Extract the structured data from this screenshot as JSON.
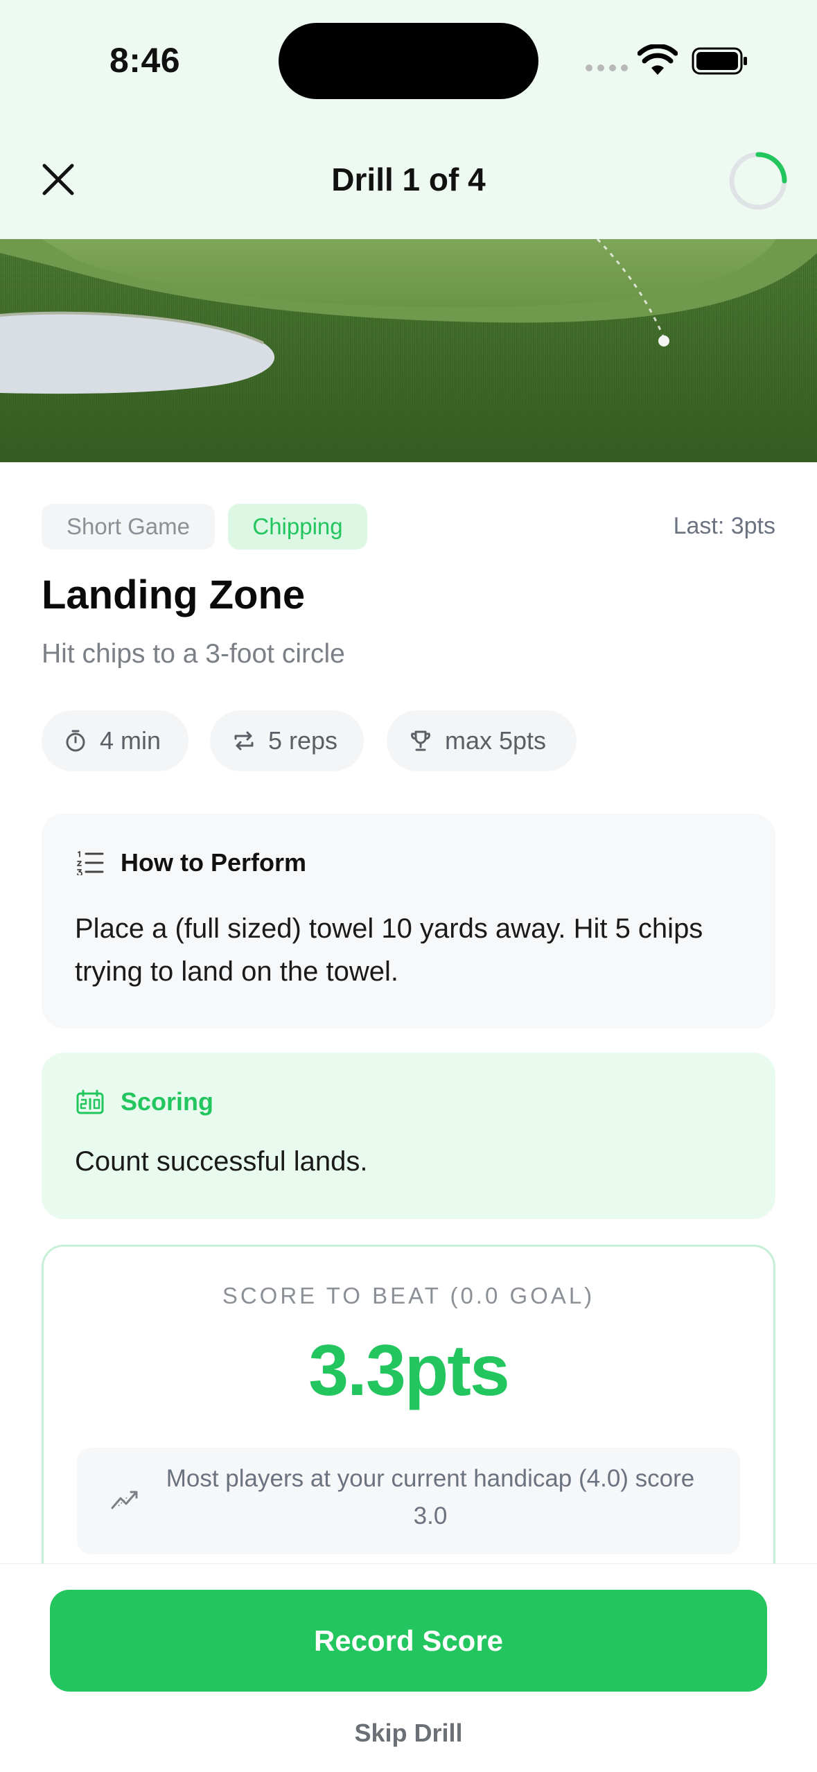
{
  "status_bar": {
    "time": "8:46"
  },
  "header": {
    "title": "Drill 1 of 4",
    "progress": 0.25
  },
  "drill": {
    "tags": [
      "Short Game",
      "Chipping"
    ],
    "last": "Last: 3pts",
    "name": "Landing Zone",
    "subtitle": "Hit chips to a 3-foot circle",
    "meta": {
      "duration": "4 min",
      "reps": "5 reps",
      "max": "max 5pts"
    }
  },
  "how": {
    "heading": "How to Perform",
    "text": "Place a (full sized) towel 10 yards away. Hit 5 chips trying to land on the towel."
  },
  "scoring": {
    "heading": "Scoring",
    "text": "Count successful lands."
  },
  "score_to_beat": {
    "label": "SCORE TO BEAT (0.0 GOAL)",
    "value": "3.3pts",
    "hint": "Most players at your current handicap (4.0) score 3.0"
  },
  "actions": {
    "record": "Record Score",
    "skip": "Skip Drill"
  },
  "colors": {
    "accent": "#22c55e",
    "header_bg": "#eefaf1"
  },
  "icons": [
    "close-icon",
    "timer-icon",
    "repeat-icon",
    "trophy-icon",
    "list-icon",
    "scoreboard-icon",
    "trend-icon",
    "wifi-icon",
    "battery-icon"
  ]
}
